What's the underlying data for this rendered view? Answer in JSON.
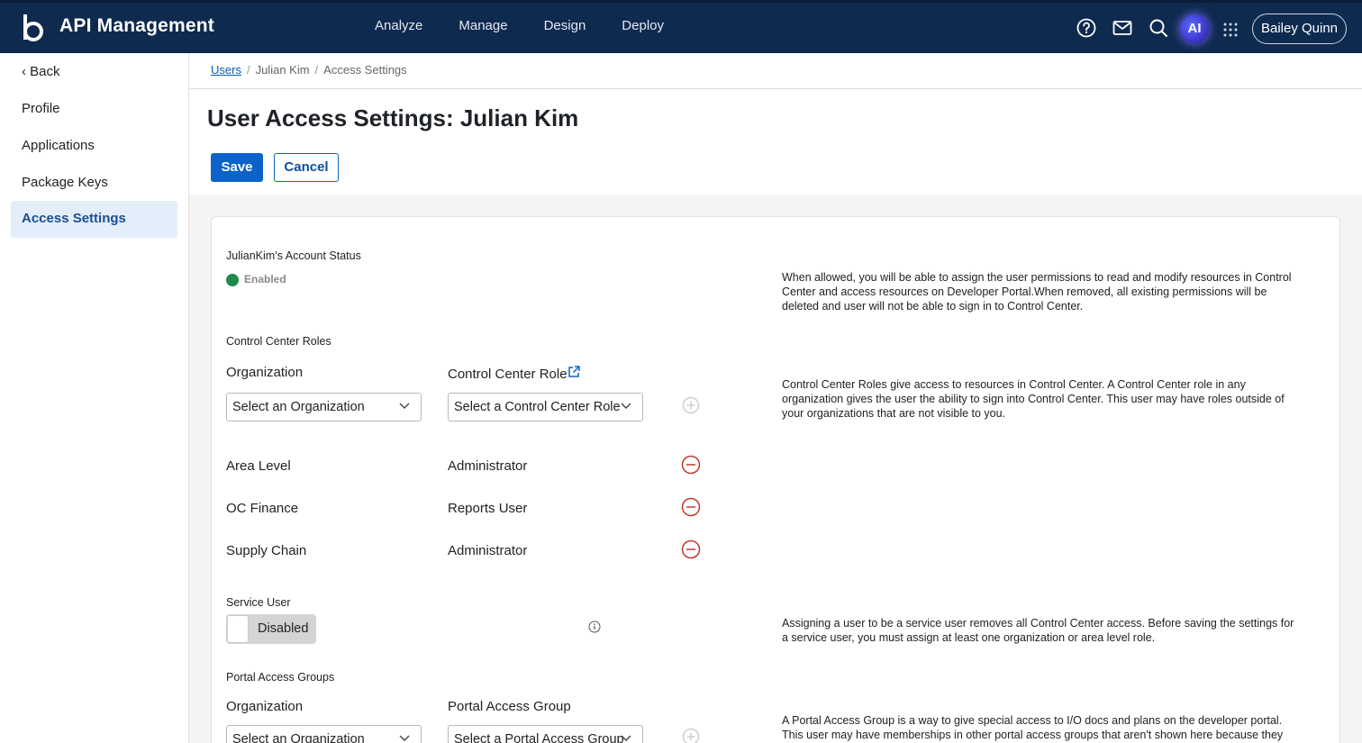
{
  "header": {
    "app_title": "API Management",
    "nav": [
      "Analyze",
      "Manage",
      "Design",
      "Deploy"
    ],
    "ai_label": "AI",
    "user_name": "Bailey Quinn",
    "colors": {
      "bar": "#0f2a4f",
      "accent": "#0b63c9"
    },
    "icons": [
      "help-icon",
      "mail-icon",
      "search-icon",
      "apps-grid-icon"
    ]
  },
  "sidebar": {
    "back": "‹ Back",
    "items": [
      "Profile",
      "Applications",
      "Package Keys",
      "Access Settings"
    ],
    "active": "Access Settings"
  },
  "breadcrumb": {
    "users": "Users",
    "user": "Julian Kim",
    "current": "Access Settings"
  },
  "page": {
    "title": "User Access Settings: Julian Kim",
    "save": "Save",
    "cancel": "Cancel"
  },
  "account_status": {
    "label": "JulianKim’s Account Status",
    "status": "Enabled",
    "description": "When allowed, you will be able to assign the user permissions to read and modify resources in Control Center and access resources on Developer Portal.When removed, all existing permissions will be deleted and user will not be able to sign in to Control Center."
  },
  "control_center_roles": {
    "section_label": "Control Center Roles",
    "org_header": "Organization",
    "role_header": "Control Center Role",
    "org_placeholder": "Select an Organization",
    "role_placeholder": "Select a Control Center Role",
    "description": "Control Center Roles give access to resources in Control Center. A Control Center role in any organization gives the user the ability to sign into Control Center. This user may have roles outside of your organizations that are not visible to you.",
    "rows": [
      {
        "org": "Area Level",
        "role": "Administrator"
      },
      {
        "org": "OC Finance",
        "role": "Reports User"
      },
      {
        "org": "Supply Chain",
        "role": "Administrator"
      }
    ]
  },
  "service_user": {
    "label": "Service User",
    "toggle_label": "Disabled",
    "description": "Assigning a user to be a service user removes all Control Center access. Before saving the settings for a service user, you must assign at least one organization or area level role."
  },
  "portal_access_groups": {
    "section_label": "Portal Access Groups",
    "org_header": "Organization",
    "group_header": "Portal Access Group",
    "org_placeholder": "Select an Organization",
    "group_placeholder": "Select a Portal Access Group",
    "description": "A Portal Access Group is a way to give special access to I/O docs and plans on the developer portal. This user may have memberships in other portal access groups that aren't shown here because they are"
  }
}
